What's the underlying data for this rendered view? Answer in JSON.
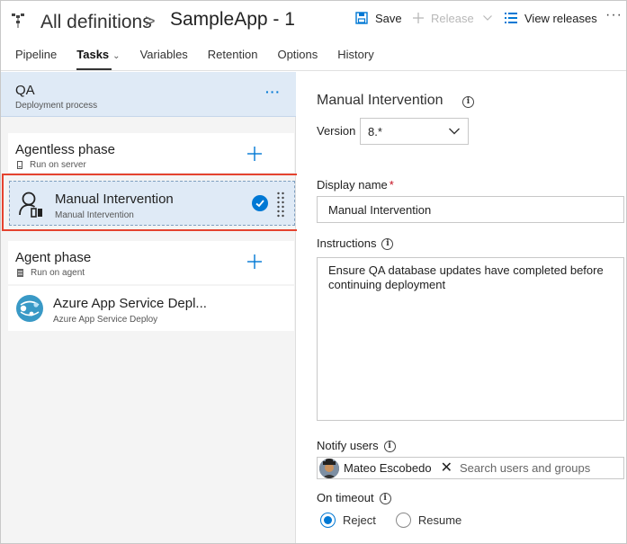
{
  "header": {
    "breadcrumb_root": "All definitions",
    "breadcrumb_sep": ">",
    "definition_name": "SampleApp - 1",
    "save_label": "Save",
    "release_label": "Release",
    "view_releases_label": "View releases",
    "more_label": "···"
  },
  "tabs": [
    {
      "label": "Pipeline",
      "active": false
    },
    {
      "label": "Tasks",
      "active": true
    },
    {
      "label": "Variables",
      "active": false
    },
    {
      "label": "Retention",
      "active": false
    },
    {
      "label": "Options",
      "active": false
    },
    {
      "label": "History",
      "active": false
    }
  ],
  "stage": {
    "title": "QA",
    "subtitle": "Deployment process",
    "more_label": "···"
  },
  "phases": [
    {
      "title": "Agentless phase",
      "subtitle": "Run on server",
      "icon": "server-icon"
    },
    {
      "title": "Agent phase",
      "subtitle": "Run on agent",
      "icon": "agent-icon"
    }
  ],
  "tasks": [
    {
      "name": "Manual Intervention",
      "subtitle": "Manual Intervention",
      "icon": "manual-intervention-icon",
      "selected": true
    },
    {
      "name": "Azure App Service Depl...",
      "subtitle": "Azure App Service Deploy",
      "icon": "azure-app-service-icon",
      "selected": false
    }
  ],
  "details": {
    "title": "Manual Intervention",
    "version_label": "Version",
    "version_value": "8.*",
    "display_name_label": "Display name",
    "required_mark": "*",
    "display_name_value": "Manual Intervention",
    "instructions_label": "Instructions",
    "instructions_value": "Ensure QA database updates have completed before continuing deployment",
    "notify_label": "Notify users",
    "notify_user": "Mateo Escobedo",
    "notify_remove": "✕",
    "notify_placeholder": "Search users and groups",
    "timeout_label": "On timeout",
    "timeout_options": [
      {
        "label": "Reject",
        "selected": true
      },
      {
        "label": "Resume",
        "selected": false
      }
    ]
  },
  "colors": {
    "accent": "#0078d4",
    "selection_border": "#e5432f",
    "stage_bg": "#dfeaf6"
  }
}
